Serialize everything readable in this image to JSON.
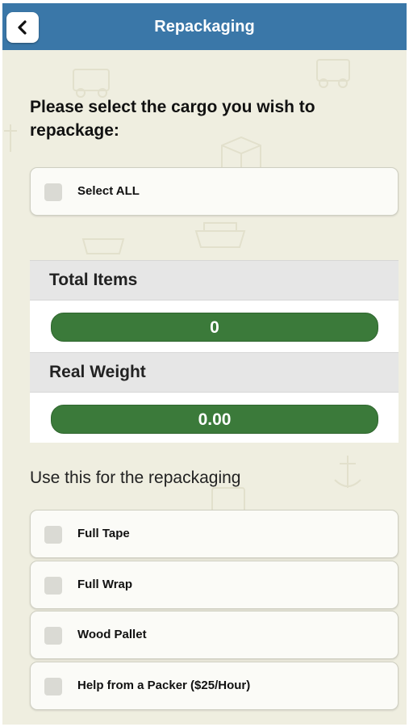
{
  "header": {
    "title": "Repackaging",
    "back_icon": "chevron-left-icon"
  },
  "prompt": "Please select the cargo you wish to repackage:",
  "select_all": {
    "label": "Select ALL",
    "checked": false
  },
  "summary": {
    "total_items": {
      "label": "Total Items",
      "value": "0"
    },
    "real_weight": {
      "label": "Real Weight",
      "value": "0.00"
    }
  },
  "options_heading": "Use this for the repackaging",
  "options": [
    {
      "label": "Full Tape",
      "checked": false
    },
    {
      "label": "Full Wrap",
      "checked": false
    },
    {
      "label": "Wood Pallet",
      "checked": false
    },
    {
      "label": "Help from a Packer ($25/Hour)",
      "checked": false
    }
  ],
  "colors": {
    "header": "#3a77a8",
    "background": "#efeee0",
    "value_pill": "#3b7a3a"
  }
}
